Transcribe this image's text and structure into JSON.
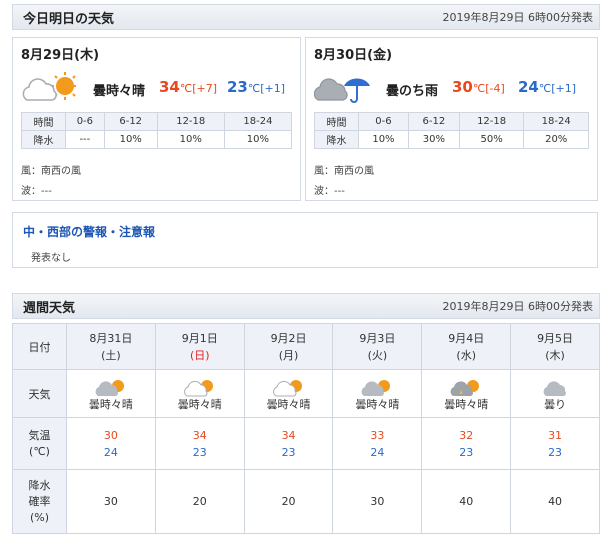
{
  "today_section": {
    "title": "今日明日の天気",
    "issued": "2019年8月29日 6時00分発表"
  },
  "days": [
    {
      "date": "8月29日(木)",
      "icon": "cloudy-then-sunny-icon",
      "condition": "曇時々晴",
      "high": "34",
      "high_unit": "℃",
      "high_diff": "[+7]",
      "low": "23",
      "low_unit": "℃",
      "low_diff": "[+1]",
      "rain_header": [
        "時間",
        "0-6",
        "6-12",
        "12-18",
        "18-24"
      ],
      "rain_values": [
        "降水",
        "---",
        "10%",
        "10%",
        "10%"
      ],
      "wind": "風：南西の風",
      "wave": "波：---"
    },
    {
      "date": "8月30日(金)",
      "icon": "cloudy-then-rain-icon",
      "condition": "曇のち雨",
      "high": "30",
      "high_unit": "℃",
      "high_diff": "[-4]",
      "low": "24",
      "low_unit": "℃",
      "low_diff": "[+1]",
      "rain_header": [
        "時間",
        "0-6",
        "6-12",
        "12-18",
        "18-24"
      ],
      "rain_values": [
        "降水",
        "10%",
        "30%",
        "50%",
        "20%"
      ],
      "wind": "風：南西の風",
      "wave": "波：---"
    }
  ],
  "warnings": {
    "title": "中・西部の警報・注意報",
    "text": "発表なし"
  },
  "weekly_section": {
    "title": "週間天気",
    "issued": "2019年8月29日 6時00分発表"
  },
  "weekly": {
    "labels": {
      "date": "日付",
      "weather": "天気",
      "temp_1": "気温",
      "temp_2": "(℃)",
      "rain_1": "降水",
      "rain_2": "確率",
      "rain_3": "(%)"
    },
    "days": [
      {
        "date": "8月31日",
        "weekday": "(土)",
        "icon": "cloudy-sunny-icon",
        "condition": "曇時々晴",
        "high": "30",
        "low": "24",
        "rain": "30"
      },
      {
        "date": "9月1日",
        "weekday": "(日)",
        "icon": "cloudy-sunny-icon",
        "condition": "曇時々晴",
        "high": "34",
        "low": "23",
        "rain": "20"
      },
      {
        "date": "9月2日",
        "weekday": "(月)",
        "icon": "cloudy-sunny-icon",
        "condition": "曇時々晴",
        "high": "34",
        "low": "23",
        "rain": "20"
      },
      {
        "date": "9月3日",
        "weekday": "(火)",
        "icon": "cloudy-sunny-icon",
        "condition": "曇時々晴",
        "high": "33",
        "low": "24",
        "rain": "30"
      },
      {
        "date": "9月4日",
        "weekday": "(水)",
        "icon": "cloudy-sunny-rain-icon",
        "condition": "曇時々晴",
        "high": "32",
        "low": "23",
        "rain": "40"
      },
      {
        "date": "9月5日",
        "weekday": "(木)",
        "icon": "cloudy-icon",
        "condition": "曇り",
        "high": "31",
        "low": "23",
        "rain": "40"
      }
    ]
  },
  "colors": {
    "high_temp": "#e84a1e",
    "low_temp": "#2a6ac7",
    "sunday": "#e62020",
    "sun": "#f29a1b",
    "cloud": "#a9aeb5",
    "umbrella": "#2f6fd0"
  }
}
